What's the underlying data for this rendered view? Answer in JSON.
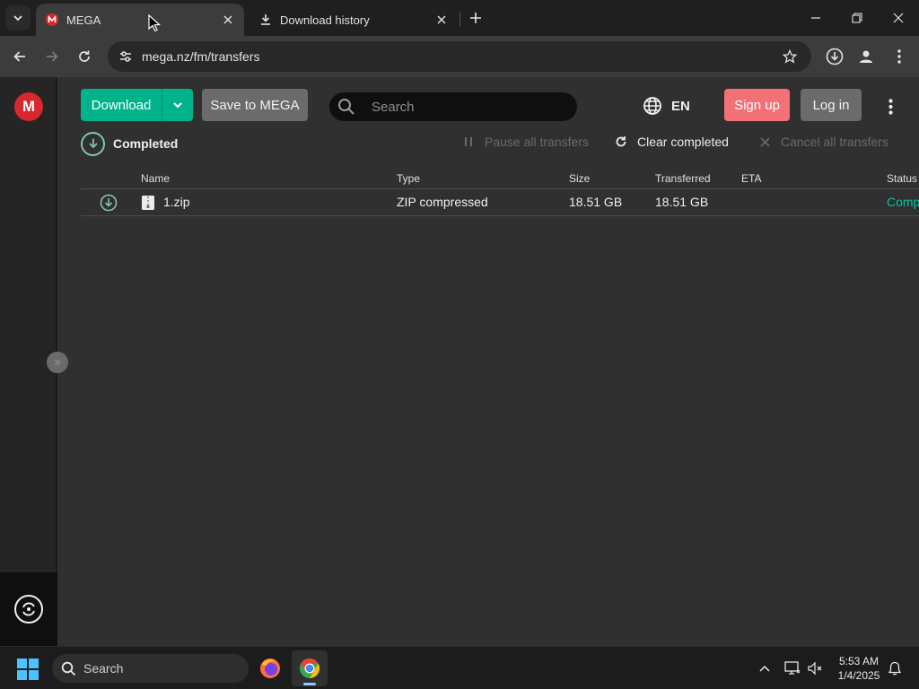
{
  "browser": {
    "tabs": [
      {
        "title": "MEGA",
        "active": true,
        "favicon": "mega-favicon"
      },
      {
        "title": "Download history",
        "active": false,
        "favicon": "download-icon"
      }
    ],
    "address": "mega.nz/fm/transfers"
  },
  "header": {
    "download_label": "Download",
    "save_label": "Save to MEGA",
    "search_placeholder": "Search",
    "language": "EN",
    "signup_label": "Sign up",
    "login_label": "Log in"
  },
  "sidebar": {
    "logo_letter": "M"
  },
  "transfers": {
    "filter_label": "Completed",
    "actions": {
      "pause_all": "Pause all transfers",
      "clear_completed": "Clear completed",
      "cancel_all": "Cancel all transfers"
    },
    "columns": [
      "Name",
      "Type",
      "Size",
      "Transferred",
      "ETA",
      "Status"
    ],
    "rows": [
      {
        "name": "1.zip",
        "type": "ZIP compressed",
        "size": "18.51 GB",
        "transferred": "18.51 GB",
        "eta": "",
        "status": "Completed"
      }
    ]
  },
  "taskbar": {
    "search_label": "Search",
    "time": "5:53 AM",
    "date": "1/4/2025"
  },
  "colors": {
    "accent_green": "#00b38b",
    "signup_red": "#f27176",
    "mega_red": "#d9272e",
    "status_complete": "#00c8a0"
  }
}
